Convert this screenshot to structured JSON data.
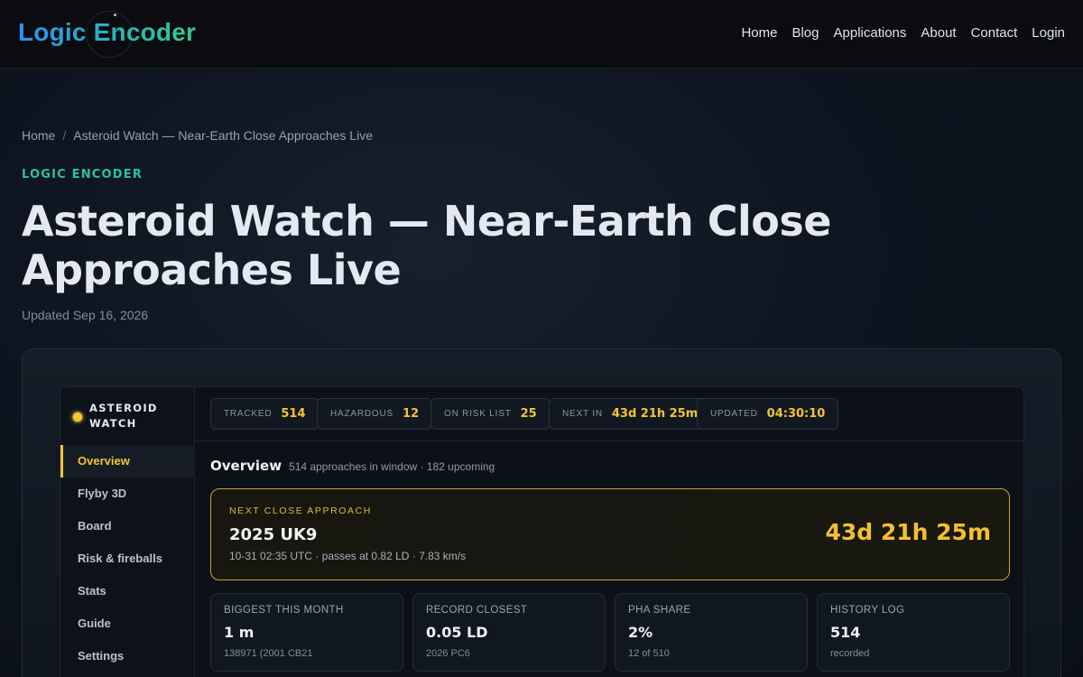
{
  "site": {
    "logo": "Logic Encoder",
    "nav": [
      "Home",
      "Blog",
      "Applications",
      "About",
      "Contact",
      "Login"
    ]
  },
  "breadcrumb": {
    "home": "Home",
    "separator": "/",
    "current": "Asteroid Watch — Near-Earth Close Approaches Live"
  },
  "article": {
    "kicker": "LOGIC ENCODER",
    "title": "Asteroid Watch — Near-Earth Close Approaches Live",
    "updated": "Updated Sep 16, 2026"
  },
  "app": {
    "brand": "ASTEROID WATCH",
    "sidebar": [
      "Overview",
      "Flyby 3D",
      "Board",
      "Risk & fireballs",
      "Stats",
      "Guide",
      "Settings"
    ],
    "active_item": "Overview",
    "stats": [
      {
        "label": "TRACKED",
        "value": "514"
      },
      {
        "label": "HAZARDOUS",
        "value": "12"
      },
      {
        "label": "ON RISK LIST",
        "value": "25"
      },
      {
        "label": "NEXT IN",
        "value": "43d 21h 25m"
      },
      {
        "label": "UPDATED",
        "value": "04:30:10"
      }
    ],
    "overview": {
      "title": "Overview",
      "subtitle": "514 approaches in window · 182 upcoming"
    },
    "next_approach": {
      "label": "NEXT CLOSE APPROACH",
      "name": "2025 UK9",
      "detail": "10-31 02:35 UTC · passes at 0.82 LD · 7.83 km/s",
      "countdown": "43d 21h 25m"
    },
    "metrics": [
      {
        "label": "BIGGEST THIS MONTH",
        "value": "1 m",
        "sub": "138971 (2001 CB21"
      },
      {
        "label": "RECORD CLOSEST",
        "value": "0.05 LD",
        "sub": "2026 PC6"
      },
      {
        "label": "PHA SHARE",
        "value": "2%",
        "sub": "12 of 510"
      },
      {
        "label": "HISTORY LOG",
        "value": "514",
        "sub": "recorded"
      }
    ],
    "colors": {
      "accent": "#f5c431",
      "brand_teal": "#2cc3a2"
    }
  }
}
